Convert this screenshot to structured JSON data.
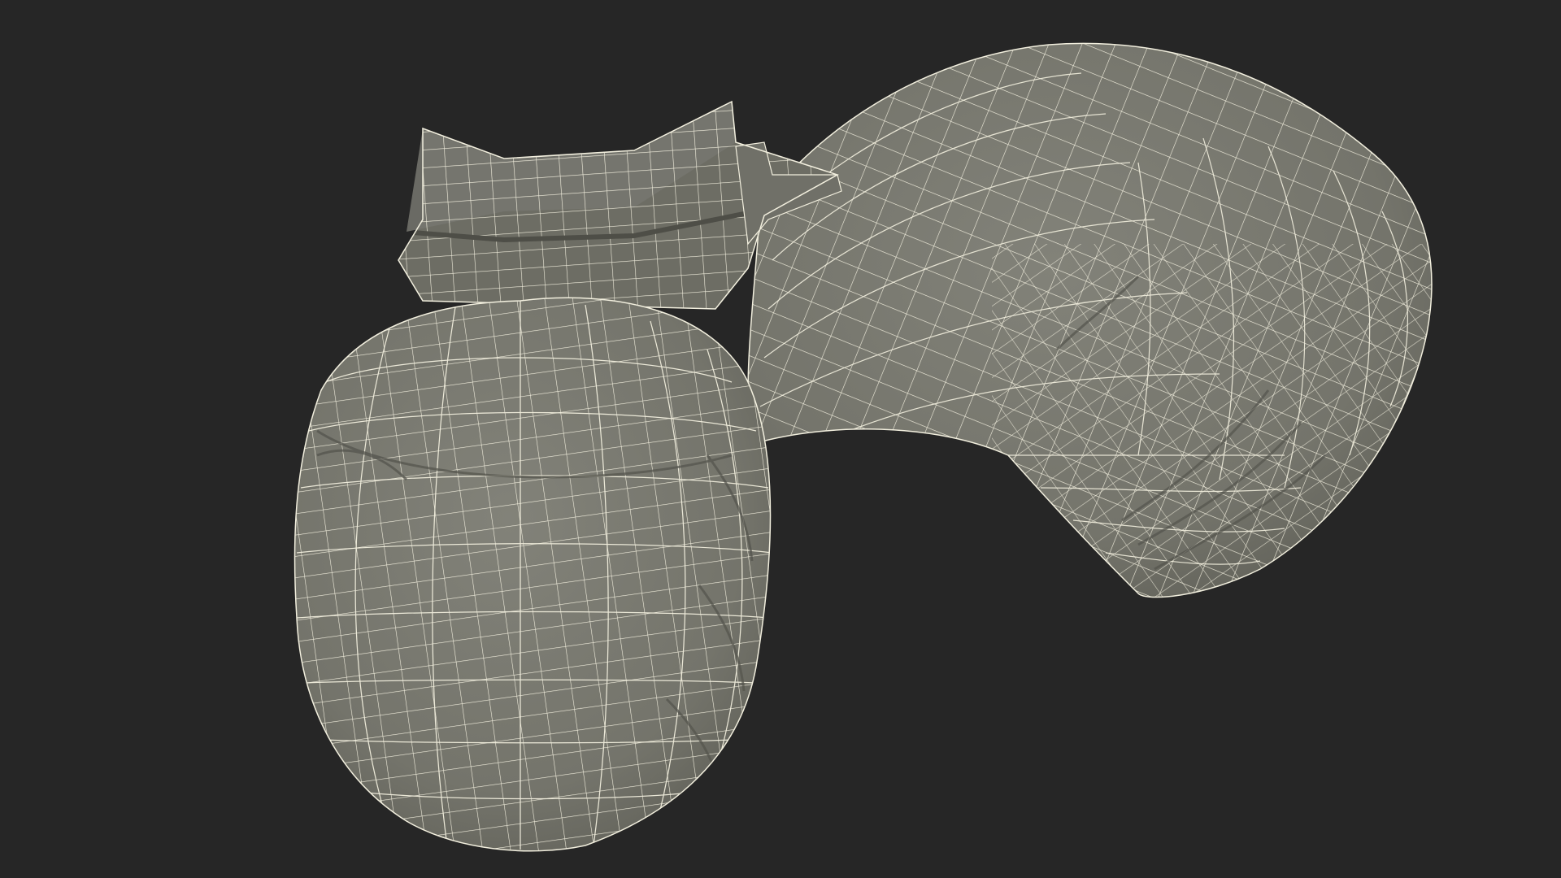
{
  "scene": {
    "background_color": "#262626",
    "mesh_color": "#7a7a70",
    "mesh_shadow_color": "#5c5c54",
    "wire_color": "#f2efde",
    "render_style": "wireframe over flat shaded mesh",
    "objects": [
      "front-boxing-glove-mesh",
      "rear-boxing-glove-mesh"
    ]
  }
}
